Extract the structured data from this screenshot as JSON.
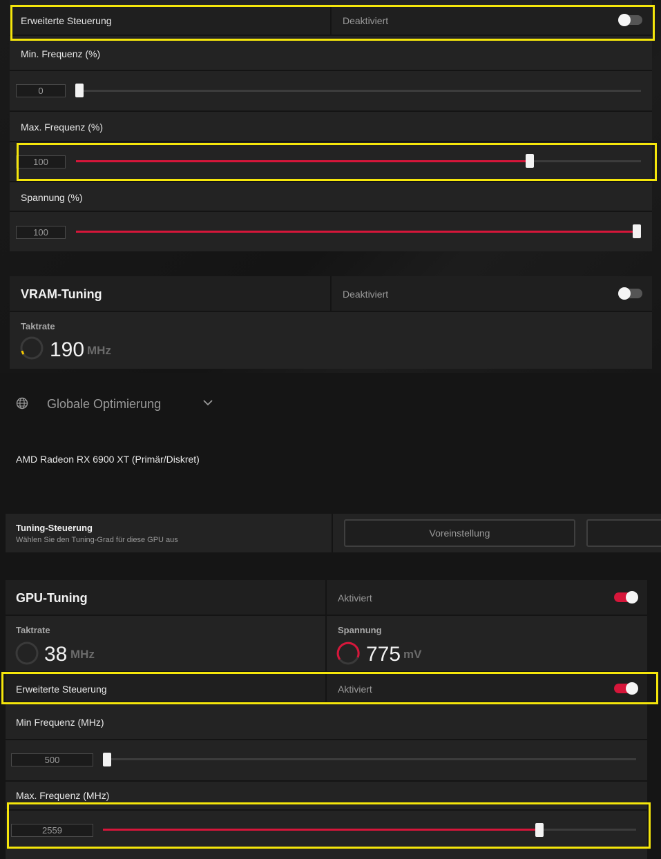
{
  "top_panel": {
    "advanced_control": {
      "label": "Erweiterte Steuerung",
      "state": "Deaktiviert"
    },
    "min_freq": {
      "label": "Min. Frequenz (%)",
      "value": "0",
      "fill": 0
    },
    "max_freq": {
      "label": "Max. Frequenz (%)",
      "value": "100",
      "fill": 0.81
    },
    "voltage": {
      "label": "Spannung (%)",
      "value": "100",
      "fill": 1.0
    }
  },
  "vram": {
    "title": "VRAM-Tuning",
    "state": "Deaktiviert",
    "clock_label": "Taktrate",
    "clock_value": "190",
    "clock_unit": "MHz"
  },
  "global": {
    "label": "Globale Optimierung",
    "gpu_name": "AMD Radeon RX 6900 XT (Primär/Diskret)"
  },
  "tuning_control": {
    "title": "Tuning-Steuerung",
    "subtitle": "Wählen Sie den Tuning-Grad für diese GPU aus",
    "preset_button": "Voreinstellung"
  },
  "gpu": {
    "title": "GPU-Tuning",
    "state": "Aktiviert",
    "clock_label": "Taktrate",
    "clock_value": "38",
    "clock_unit": "MHz",
    "voltage_label": "Spannung",
    "voltage_value": "775",
    "voltage_unit": "mV",
    "advanced_control": {
      "label": "Erweiterte Steuerung",
      "state": "Aktiviert"
    },
    "min_freq": {
      "label": "Min Frequenz (MHz)",
      "value": "500",
      "fill": 0
    },
    "max_freq": {
      "label": "Max. Frequenz (MHz)",
      "value": "2559",
      "fill": 0.82
    }
  },
  "colors": {
    "accent": "#d6163a",
    "highlight": "#f5e60b",
    "panel": "#232323"
  }
}
